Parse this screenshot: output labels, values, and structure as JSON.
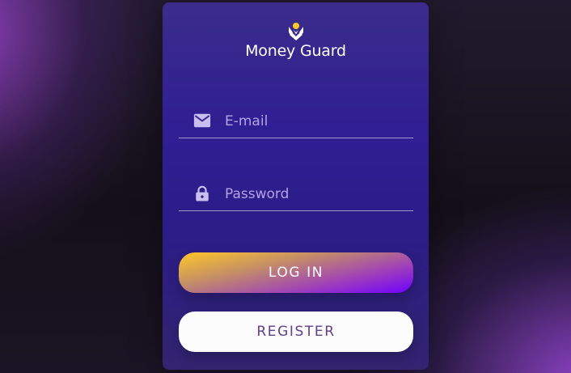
{
  "app": {
    "name": "Money Guard",
    "logo_icon": "money-guard-logo-icon"
  },
  "form": {
    "email": {
      "icon": "mail-icon",
      "placeholder": "E-mail",
      "value": ""
    },
    "password": {
      "icon": "lock-icon",
      "placeholder": "Password",
      "value": ""
    },
    "login_label": "LOG IN",
    "register_label": "REGISTER"
  },
  "colors": {
    "card_top": "#3b2c8b",
    "card_mid": "#301e93",
    "login_gradient_start": "#ffc727",
    "login_gradient_end": "#7000ff",
    "register_bg": "#fcfcfc",
    "register_text": "#623f8b",
    "logo_accent": "#ffc727"
  }
}
